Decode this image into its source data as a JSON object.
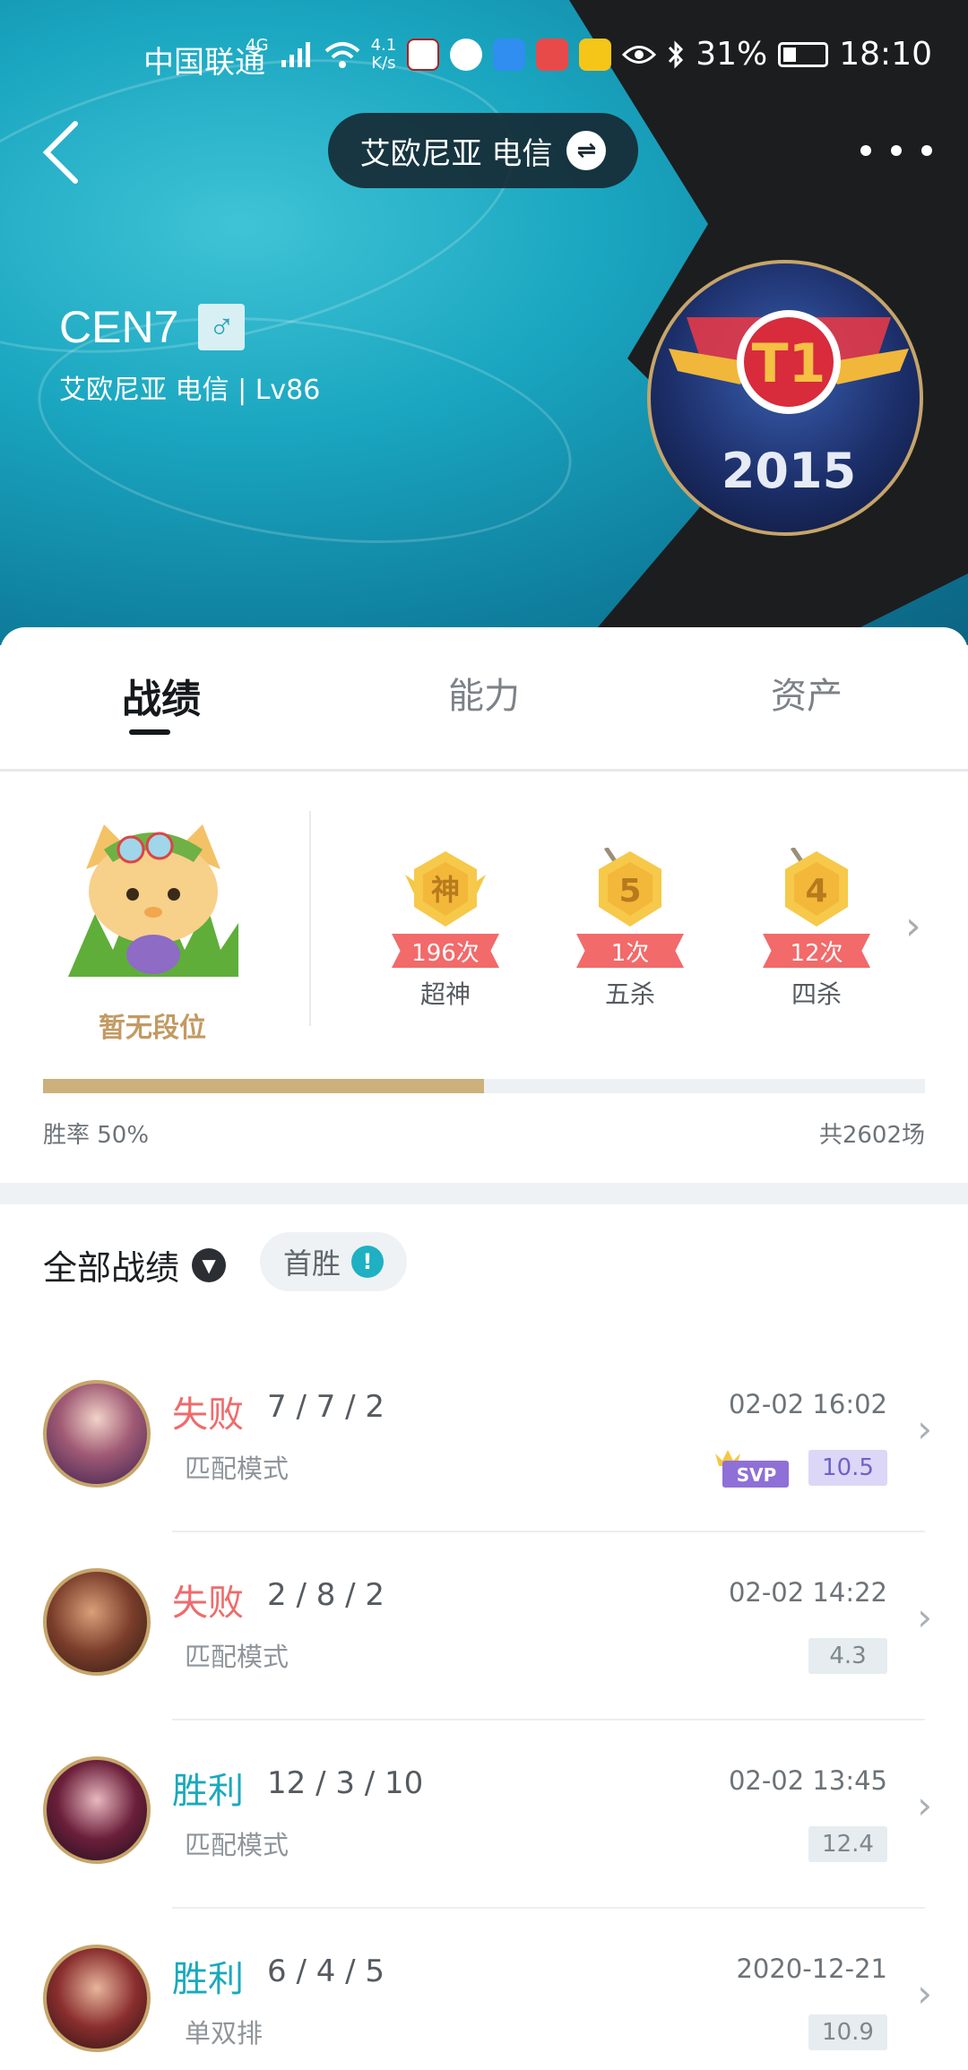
{
  "status_bar": {
    "carrier": "中国联通",
    "network": "4G",
    "speed_value": "4.1",
    "speed_unit": "K/s",
    "battery": "31%",
    "time": "18:10"
  },
  "header": {
    "server_label": "艾欧尼亚 电信",
    "player_name": "CEN7",
    "player_sub": "艾欧尼亚 电信 | Lv86",
    "gender_symbol": "♂",
    "swap_symbol": "⇌",
    "avatar_text_top": "T1",
    "avatar_text_bottom": "2015"
  },
  "tabs": [
    {
      "label": "战绩",
      "active": true
    },
    {
      "label": "能力",
      "active": false
    },
    {
      "label": "资产",
      "active": false
    }
  ],
  "rank": {
    "label": "暂无段位"
  },
  "badges": [
    {
      "glyph": "神",
      "count": "196次",
      "name": "超神"
    },
    {
      "glyph": "5",
      "count": "1次",
      "name": "五杀"
    },
    {
      "glyph": "4",
      "count": "12次",
      "name": "四杀"
    }
  ],
  "summary": {
    "win_rate_label": "胜率  50%",
    "win_rate_value": 0.5,
    "total_games": "共2602场"
  },
  "filters": {
    "all_label": "全部战绩",
    "first_win_label": "首胜",
    "info_symbol": "!"
  },
  "matches": [
    {
      "result": "失败",
      "outcome": "lose",
      "kda": "7 / 7 / 2",
      "mode": "匹配模式",
      "time": "02-02 16:02",
      "score": "10.5",
      "svp": true,
      "svp_label": "SVP"
    },
    {
      "result": "失败",
      "outcome": "lose",
      "kda": "2 / 8 / 2",
      "mode": "匹配模式",
      "time": "02-02 14:22",
      "score": "4.3",
      "svp": false
    },
    {
      "result": "胜利",
      "outcome": "win",
      "kda": "12 / 3 / 10",
      "mode": "匹配模式",
      "time": "02-02 13:45",
      "score": "12.4",
      "svp": false
    },
    {
      "result": "胜利",
      "outcome": "win",
      "kda": "6 / 4 / 5",
      "mode": "单双排",
      "time": "2020-12-21",
      "score": "10.9",
      "svp": false
    }
  ],
  "colors": {
    "teal": "#19a9bd",
    "lose_red": "#ef6b6b",
    "gold": "#c6a56b",
    "progress_fill": "#cdb17c"
  }
}
